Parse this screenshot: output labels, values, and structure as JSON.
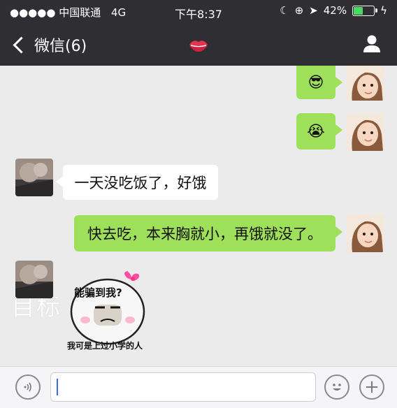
{
  "statusbar": {
    "carrier": "●●●●● 中国联通",
    "network": "4G",
    "time": "下午8:37",
    "battery": "42%",
    "battery_level": 0.42
  },
  "navbar": {
    "back_label": "微信(6)",
    "contact_icon": "lips-icon",
    "profile_icon": "person-icon"
  },
  "messages": [
    {
      "side": "right",
      "type": "emoji",
      "emoji": "😎"
    },
    {
      "side": "right",
      "type": "emoji",
      "emoji": "😭"
    },
    {
      "side": "left",
      "type": "text",
      "text": "一天没吃饭了，好饿"
    },
    {
      "side": "right",
      "type": "text",
      "text": "快去吃，本来胸就小，再饿就没了。"
    },
    {
      "side": "left",
      "type": "sticker",
      "top_text": "能骗到我?",
      "bottom_text": "我可是上过小学的人"
    }
  ],
  "watermark": "目标",
  "inputbar": {
    "voice_icon": "voice-icon",
    "emoji_icon": "emoji-icon",
    "plus_icon": "plus-icon"
  },
  "colors": {
    "header": "#2f2f33",
    "bubble_green": "#9fe05a",
    "chat_bg": "#ebebeb"
  }
}
